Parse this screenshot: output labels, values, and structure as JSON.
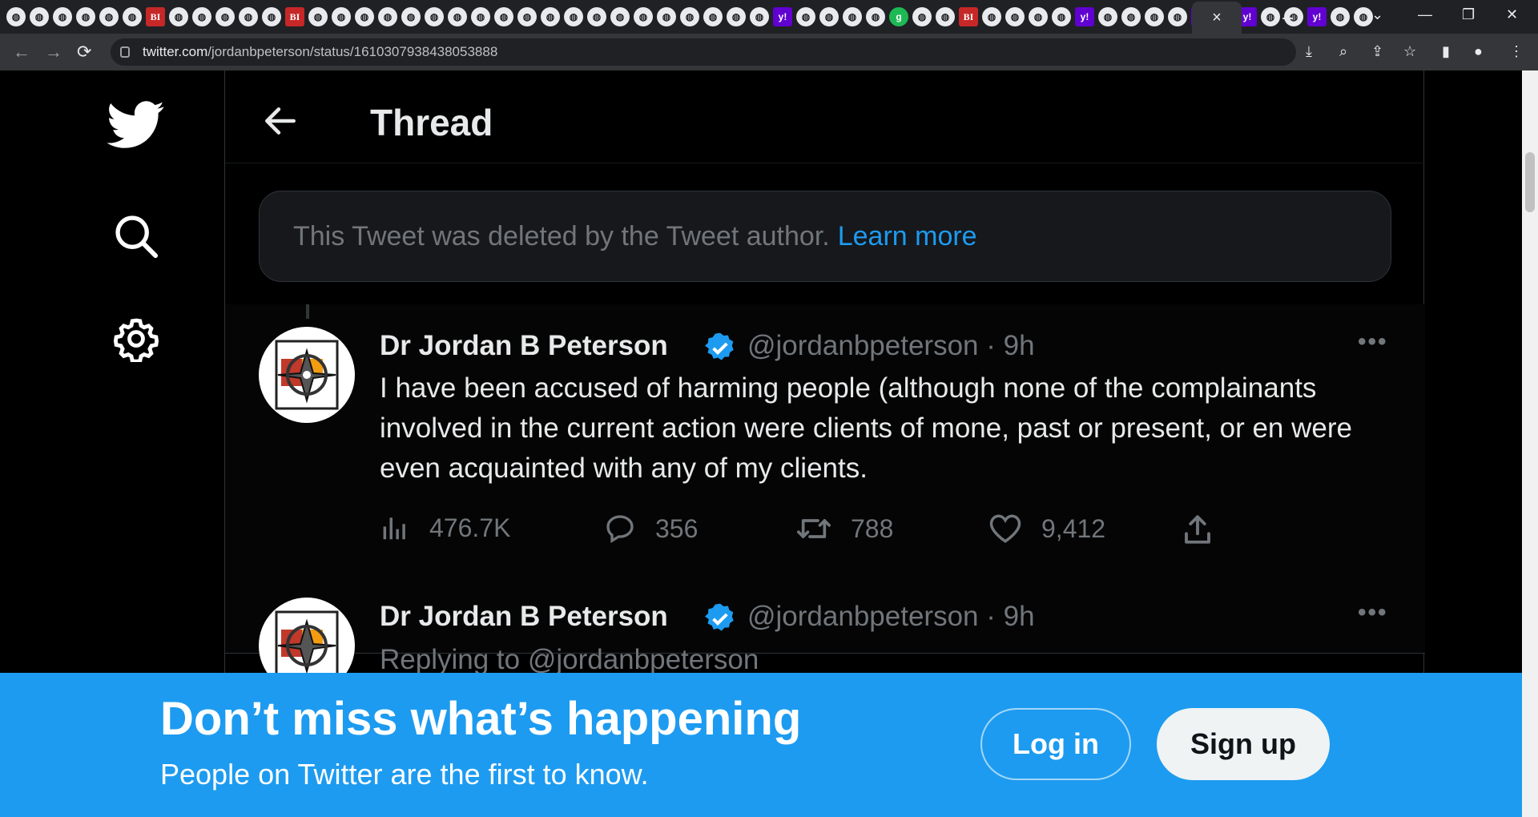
{
  "browser": {
    "url_host": "twitter.com",
    "url_path": "/jordanbpeterson/status/1610307938438053888",
    "tab_icons": [
      "globe",
      "site",
      "site",
      "site",
      "site",
      "site",
      "bi",
      "site",
      "site",
      "site",
      "site",
      "site",
      "bi",
      "site",
      "site",
      "site",
      "site",
      "site",
      "site",
      "site",
      "site",
      "site",
      "site",
      "site",
      "site",
      "site",
      "site",
      "site",
      "site",
      "site",
      "site",
      "site",
      "site",
      "y",
      "site",
      "site",
      "site",
      "site",
      "g",
      "site",
      "site",
      "bi",
      "site",
      "site",
      "site",
      "site",
      "y",
      "site",
      "site",
      "site",
      "site",
      "y",
      "site",
      "y",
      "site",
      "site",
      "y",
      "site",
      "site"
    ],
    "active_tab_close": "×",
    "new_tab": "+"
  },
  "nav": {
    "icons": [
      "twitter-logo-icon",
      "search-icon",
      "settings-icon"
    ]
  },
  "thread": {
    "title": "Thread",
    "deleted_notice": "This Tweet was deleted by the Tweet author.",
    "learn_more": "Learn more"
  },
  "tweets": [
    {
      "name": "Dr Jordan B Peterson",
      "handle": "@jordanbpeterson",
      "time": "· 9h",
      "text": "I have been accused of harming people (although none of the complainants involved in the current action were clients of mone, past or present, or en were even acquainted with any of my clients.",
      "views": "476.7K",
      "replies": "356",
      "retweets": "788",
      "likes": "9,412"
    },
    {
      "name": "Dr Jordan B Peterson",
      "handle": "@jordanbpeterson",
      "time": "· 9h",
      "replying": "Replying to @jordanbpeterson"
    }
  ],
  "banner": {
    "title": "Don’t miss what’s happening",
    "subtitle": "People on Twitter are the first to know.",
    "login": "Log in",
    "signup": "Sign up"
  },
  "colors": {
    "accent": "#1d9bf0",
    "background": "#000000",
    "muted": "#71767b"
  }
}
